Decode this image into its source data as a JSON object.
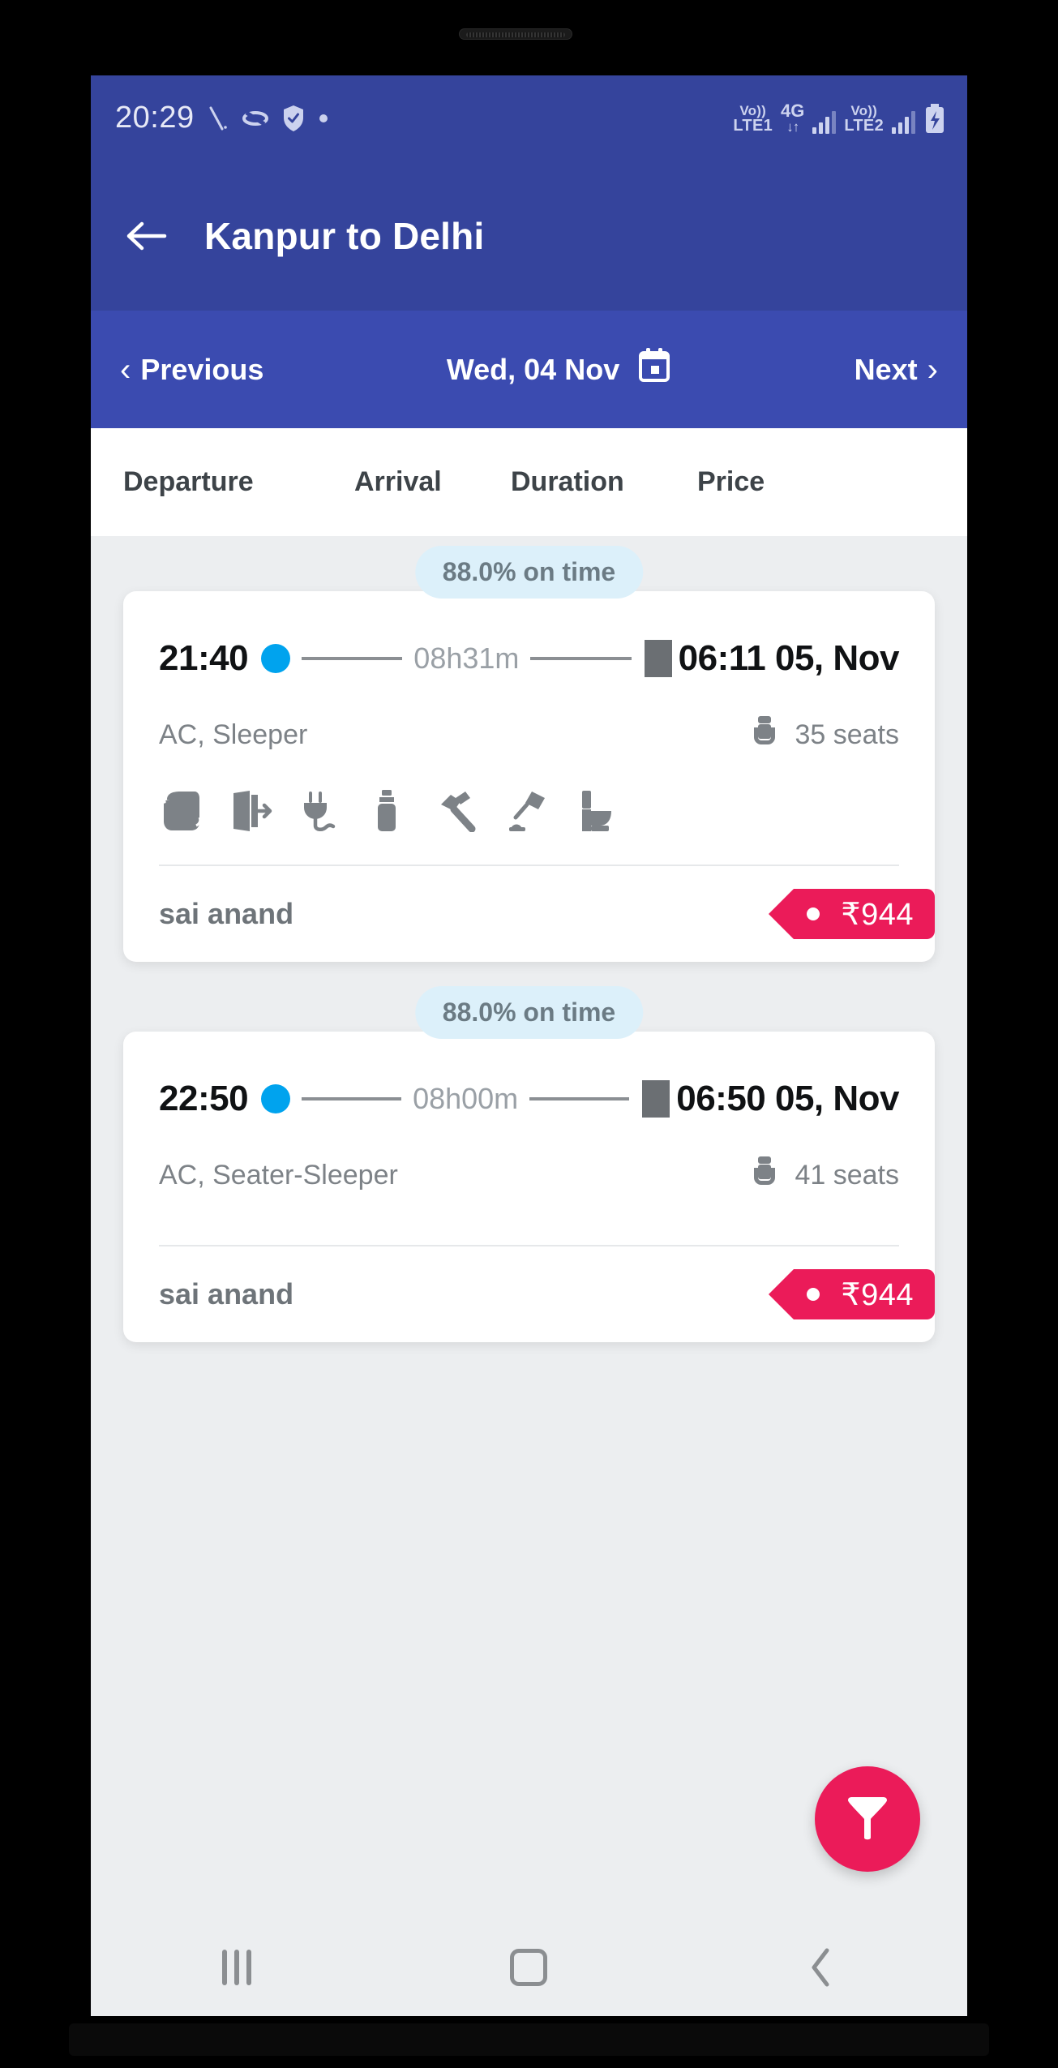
{
  "status_bar": {
    "clock": "20:29",
    "left_icons": [
      "slash-icon",
      "oval-icon",
      "shield-check-icon",
      "dot-icon"
    ],
    "sim1": {
      "line1": "Vo))",
      "line2": "LTE1"
    },
    "network": {
      "type": "4G",
      "arrows": "↓↑"
    },
    "sim2": {
      "line1": "Vo))",
      "line2": "LTE2"
    },
    "battery": "battery-charging-icon"
  },
  "app_bar": {
    "back_icon": "arrow-left-icon",
    "title": "Kanpur to Delhi"
  },
  "date_nav": {
    "previous_label": "Previous",
    "previous_chevron": "‹",
    "date_label": "Wed, 04 Nov",
    "calendar_icon": "calendar-icon",
    "next_label": "Next",
    "next_chevron": "›"
  },
  "column_headers": {
    "departure": "Departure",
    "arrival": "Arrival",
    "duration": "Duration",
    "price": "Price"
  },
  "results": [
    {
      "on_time": "88.0% on time",
      "departure_time": "21:40",
      "duration": "08h31m",
      "arrival_time": "06:11 05, Nov",
      "bus_type": "AC, Sleeper",
      "seats": "35 seats",
      "amenities": [
        "blanket-icon",
        "emergency-exit-icon",
        "charging-point-icon",
        "water-bottle-icon",
        "emergency-hammer-icon",
        "reading-light-icon",
        "toilet-icon"
      ],
      "operator": "sai anand",
      "price": "₹944"
    },
    {
      "on_time": "88.0% on time",
      "departure_time": "22:50",
      "duration": "08h00m",
      "arrival_time": "06:50 05, Nov",
      "bus_type": "AC, Seater-Sleeper",
      "seats": "41 seats",
      "amenities": [],
      "operator": "sai anand",
      "price": "₹944"
    }
  ],
  "fab": {
    "icon": "filter-funnel-icon"
  },
  "nav_bar": {
    "recents": "recents-icon",
    "home": "home-icon",
    "back": "back-chevron-icon"
  },
  "colors": {
    "status_bar": "#35449c",
    "app_bar": "#35449c",
    "date_nav": "#3b4bb0",
    "accent_pink": "#eb1b59",
    "dot_blue": "#00a3ee",
    "pill_bg": "#dcf0fa",
    "page_bg": "#eceef0"
  }
}
